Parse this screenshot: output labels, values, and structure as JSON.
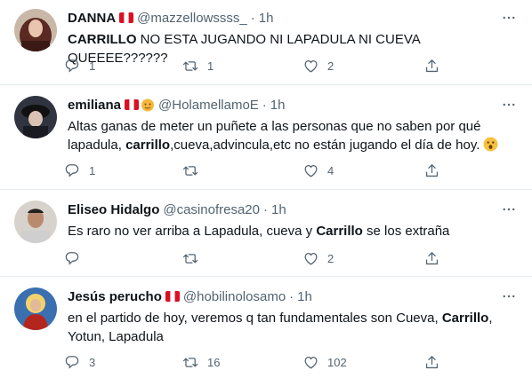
{
  "tweets": [
    {
      "name": "DANNA",
      "handle": "@mazzellowssss_",
      "dot": "·",
      "time": "1h",
      "text_parts": [
        {
          "bold": true,
          "text": "CARRILLO"
        },
        {
          "bold": false,
          "text": " NO ESTA JUGANDO NI LAPADULA NI CUEVA QUEEEE??????"
        }
      ],
      "replies": "1",
      "retweets": "1",
      "likes": "2"
    },
    {
      "name": "emiliana",
      "handle": "@HolamellamoE",
      "dot": "·",
      "time": "1h",
      "text_parts": [
        {
          "bold": false,
          "text": "Altas ganas de meter un puñete a las personas que no saben por qué lapadula, "
        },
        {
          "bold": true,
          "text": "carrillo"
        },
        {
          "bold": false,
          "text": ",cueva,advincula,etc no están jugando el día de hoy."
        }
      ],
      "replies": "1",
      "retweets": "",
      "likes": "4"
    },
    {
      "name": "Eliseo Hidalgo",
      "handle": "@casinofresa20",
      "dot": "·",
      "time": "1h",
      "text_parts": [
        {
          "bold": false,
          "text": "Es raro no ver arriba a Lapadula, cueva y "
        },
        {
          "bold": true,
          "text": "Carrillo"
        },
        {
          "bold": false,
          "text": " se los extraña"
        }
      ],
      "replies": "",
      "retweets": "",
      "likes": "2"
    },
    {
      "name": "Jesús perucho",
      "handle": "@hobilinolosamo",
      "dot": "·",
      "time": "1h",
      "text_parts": [
        {
          "bold": false,
          "text": "en el partido de hoy, veremos q tan fundamentales son Cueva, "
        },
        {
          "bold": true,
          "text": "Carrillo"
        },
        {
          "bold": false,
          "text": ", Yotun, Lapadula"
        }
      ],
      "replies": "3",
      "retweets": "16",
      "likes": "102"
    }
  ],
  "colors": {
    "text": "#0f1419",
    "secondary": "#536471",
    "divider": "#e6ecf0",
    "flag_red": "#d91023"
  },
  "icons": [
    "reply-icon",
    "retweet-icon",
    "like-icon",
    "share-icon",
    "more-icon",
    "peru-flag-icon",
    "surprised-emoji-icon"
  ]
}
